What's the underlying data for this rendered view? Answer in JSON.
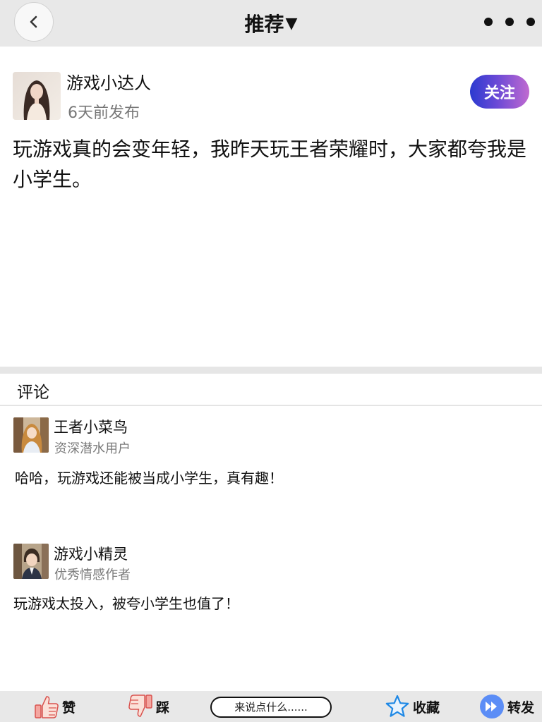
{
  "header": {
    "title": "推荐",
    "dropdown_glyph": "▼",
    "back_icon": "chevron-left-icon",
    "more_icon": "more-dots-icon"
  },
  "post": {
    "author": "游戏小达人",
    "time": "6天前发布",
    "follow_label": "关注",
    "content": "玩游戏真的会变年轻，我昨天玩王者荣耀时，大家都夸我是小学生。"
  },
  "comments_section": {
    "title": "评论",
    "items": [
      {
        "name": "王者小菜鸟",
        "role": "资深潜水用户",
        "text": "哈哈，玩游戏还能被当成小学生，真有趣！"
      },
      {
        "name": "游戏小精灵",
        "role": "优秀情感作者",
        "text": "玩游戏太投入，被夸小学生也值了！"
      }
    ]
  },
  "bottom_bar": {
    "like_label": "赞",
    "dislike_label": "踩",
    "comment_placeholder": "来说点什么......",
    "collect_label": "收藏",
    "share_label": "转发"
  },
  "colors": {
    "bar_background": "#e8e8e8",
    "follow_gradient_start": "#2b3ad0",
    "follow_gradient_end": "#c06ad0",
    "star_blue": "#1e88e5",
    "share_blue": "#5b8df6",
    "thumb_red": "#e53935"
  }
}
